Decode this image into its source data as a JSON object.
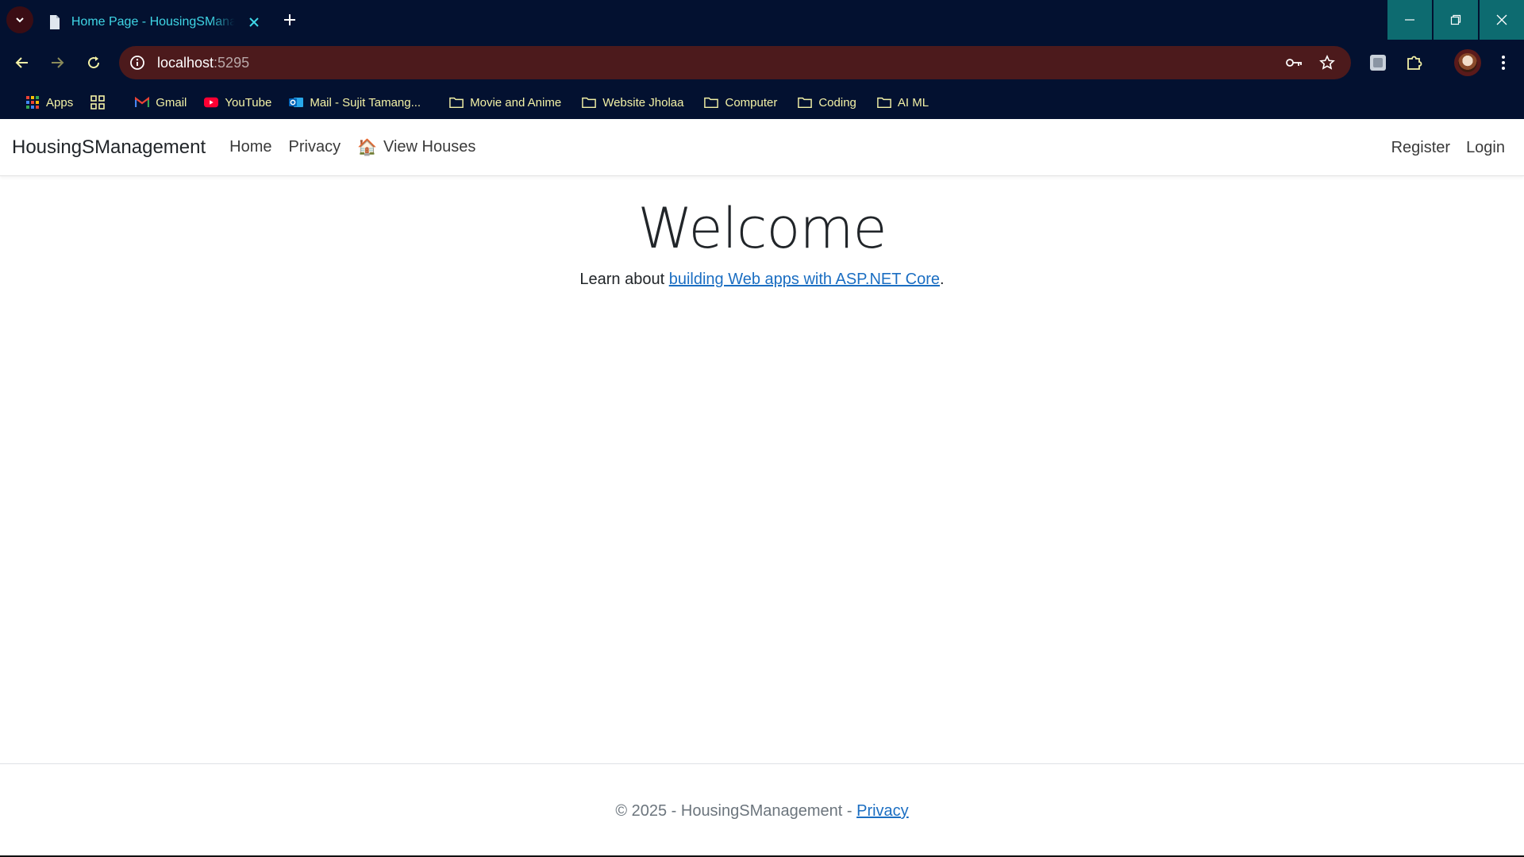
{
  "browser": {
    "tab_title": "Home Page - HousingSManagement",
    "url_host": "localhost",
    "url_port": ":5295",
    "colors": {
      "chrome": "#031130",
      "tab_text": "#3fd6e6",
      "omnibox": "#4c1a1c",
      "bookmark_text": "#f4f2a6",
      "window_controls": "#0d6b70"
    }
  },
  "bookmarks": [
    {
      "label": "Apps",
      "icon": "apps-grid-icon"
    },
    {
      "label": "",
      "icon": "tab-groups-icon"
    },
    {
      "label": "Gmail",
      "icon": "gmail-icon"
    },
    {
      "label": "YouTube",
      "icon": "youtube-icon"
    },
    {
      "label": "Mail - Sujit Tamang...",
      "icon": "outlook-icon"
    },
    {
      "label": "Movie and Anime",
      "icon": "folder-icon"
    },
    {
      "label": "Website Jholaa",
      "icon": "folder-icon"
    },
    {
      "label": "Computer",
      "icon": "folder-icon"
    },
    {
      "label": "Coding",
      "icon": "folder-icon"
    },
    {
      "label": "AI ML",
      "icon": "folder-icon"
    }
  ],
  "site": {
    "brand": "HousingSManagement",
    "nav": {
      "home": "Home",
      "privacy": "Privacy",
      "view_houses": "View Houses",
      "view_houses_icon": "🏠",
      "register": "Register",
      "login": "Login"
    },
    "hero": {
      "title": "Welcome",
      "lead_prefix": "Learn about ",
      "lead_link": "building Web apps with ASP.NET Core",
      "lead_suffix": "."
    },
    "footer": {
      "text": "© 2025 - HousingSManagement - ",
      "privacy_link": "Privacy"
    },
    "colors": {
      "link": "#1b6ec2",
      "text": "#212529"
    }
  }
}
